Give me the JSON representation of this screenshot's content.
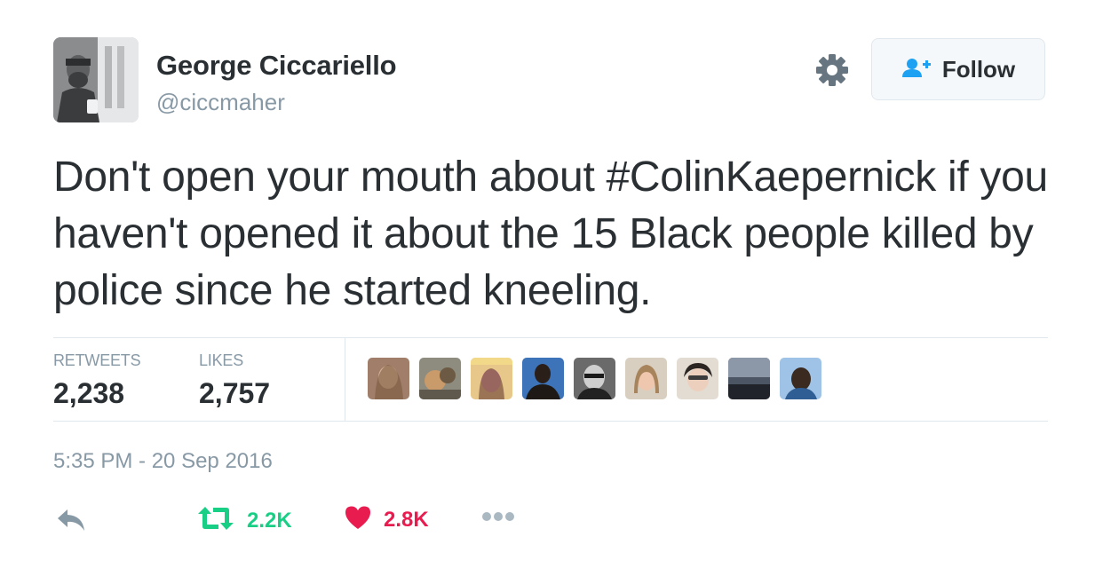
{
  "author": {
    "name": "George Ciccariello",
    "handle": "@ciccmaher",
    "avatar_icon": "profile-photo"
  },
  "header": {
    "settings_icon": "gear-icon",
    "follow_label": "Follow",
    "follow_icon": "follow-user-icon"
  },
  "tweet": {
    "text_before": "Don't open your mouth about ",
    "hashtag": "#ColinKaepernick",
    "text_after": " if you haven't opened it about the 15 Black people killed by police since he started kneeling."
  },
  "stats": {
    "retweets_label": "RETWEETS",
    "retweets_value": "2,238",
    "likes_label": "LIKES",
    "likes_value": "2,757"
  },
  "likers_count_shown": 9,
  "timestamp": "5:35 PM - 20 Sep 2016",
  "actions": {
    "reply_icon": "reply-icon",
    "retweet_icon": "retweet-icon",
    "retweet_count": "2.2K",
    "like_icon": "heart-icon",
    "like_count": "2.8K",
    "more_icon": "more-icon"
  },
  "colors": {
    "text": "#292f33",
    "muted": "#8899a6",
    "retweet_green": "#19cf86",
    "like_red": "#e81c4f",
    "follow_blue": "#1da1f2",
    "divider": "#e1e8ed"
  }
}
